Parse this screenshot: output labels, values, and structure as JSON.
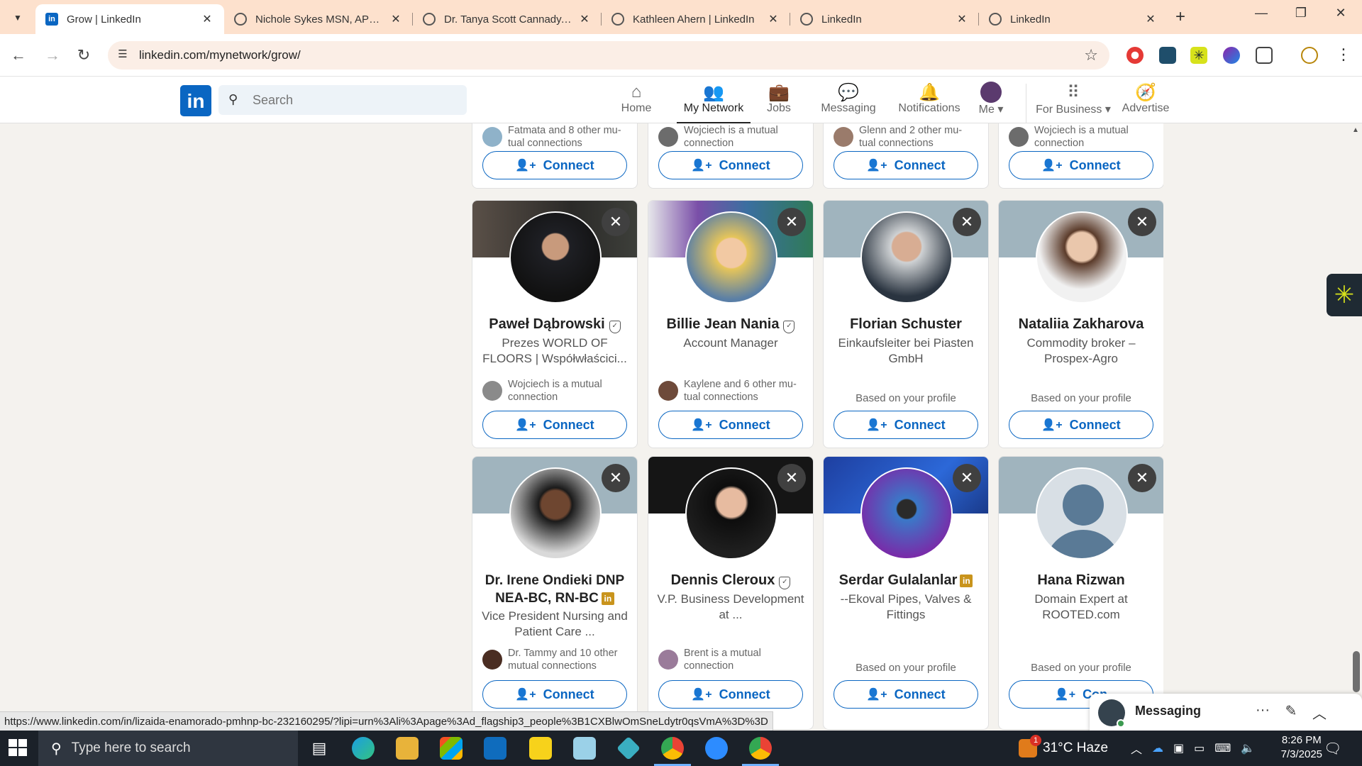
{
  "browser": {
    "tabs": [
      {
        "title": "Grow | LinkedIn",
        "favicon": "linkedin-icon",
        "active": true
      },
      {
        "title": "Nichole Sykes MSN, APRN",
        "favicon": "loading-icon"
      },
      {
        "title": "Dr. Tanya Scott Cannady, D",
        "favicon": "loading-icon"
      },
      {
        "title": "Kathleen Ahern | LinkedIn",
        "favicon": "loading-icon"
      },
      {
        "title": "LinkedIn",
        "favicon": "loading-icon"
      },
      {
        "title": "LinkedIn",
        "favicon": "loading-icon"
      }
    ],
    "url": "linkedin.com/mynetwork/grow/",
    "status_url": "https://www.linkedin.com/in/lizaida-enamorado-pmhnp-bc-232160295/?lipi=urn%3Ali%3Apage%3Ad_flagship3_people%3B1CXBlwOmSneLdytr0qsVmA%3D%3D"
  },
  "linkedin": {
    "logo": "in",
    "search_placeholder": "Search",
    "nav": [
      {
        "label": "Home",
        "icon": "home-icon"
      },
      {
        "label": "My Network",
        "icon": "network-icon",
        "active": true
      },
      {
        "label": "Jobs",
        "icon": "briefcase-icon"
      },
      {
        "label": "Messaging",
        "icon": "chat-icon"
      },
      {
        "label": "Notifications",
        "icon": "bell-icon"
      },
      {
        "label": "Me",
        "icon": "avatar"
      },
      {
        "label": "For Business",
        "icon": "grid-icon"
      },
      {
        "label": "Advertise",
        "icon": "compass-icon"
      }
    ]
  },
  "top_row": [
    {
      "mutual": "Fatmata and 8 other mu-\ntual connections",
      "connect": "Connect"
    },
    {
      "mutual": "Wojciech is a mutual\nconnection",
      "connect": "Connect"
    },
    {
      "mutual": "Glenn and 2 other mu-\ntual connections",
      "connect": "Connect"
    },
    {
      "mutual": "Wojciech is a mutual\nconnection",
      "connect": "Connect"
    }
  ],
  "row2": [
    {
      "name": "Paweł Dąbrowski",
      "badge": "verified",
      "headline": "Prezes WORLD OF FLOORS | Współwłaścici...",
      "mutual": "Wojciech is a mutual connection",
      "connect": "Connect"
    },
    {
      "name": "Billie Jean Nania",
      "badge": "verified",
      "headline": "Account Manager",
      "mutual": "Kaylene and 6 other mu-tual connections",
      "connect": "Connect"
    },
    {
      "name": "Florian Schuster",
      "badge": "",
      "headline": "Einkaufsleiter bei Piasten GmbH",
      "based": "Based on your profile",
      "connect": "Connect"
    },
    {
      "name": "Nataliia Zakharova",
      "badge": "",
      "headline": "Commodity broker – Prospex-Agro",
      "based": "Based on your profile",
      "connect": "Connect"
    }
  ],
  "row3": [
    {
      "name": "Dr. Irene Ondieki DNP NEA-BC, RN-BC",
      "badge": "linkedin",
      "headline": "Vice President Nursing and Patient Care ...",
      "mutual": "Dr. Tammy and 10 other mutual connections",
      "connect": "Connect"
    },
    {
      "name": "Dennis Cleroux",
      "badge": "verified",
      "headline": "V.P. Business Development at ...",
      "mutual": "Brent is a mutual connection",
      "connect": "Connect"
    },
    {
      "name": "Serdar Gulalanlar",
      "badge": "linkedin",
      "headline": "--Ekoval Pipes, Valves & Fittings",
      "based": "Based on your profile",
      "connect": "Connect"
    },
    {
      "name": "Hana Rizwan",
      "badge": "",
      "headline": "Domain Expert at ROOTED.com",
      "based": "Based on your profile",
      "connect": "Con"
    }
  ],
  "messaging": {
    "label": "Messaging"
  },
  "taskbar": {
    "search_placeholder": "Type here to search",
    "weather": "31°C  Haze",
    "time": "8:26 PM",
    "date": "7/3/2025",
    "notification_count": "1"
  }
}
